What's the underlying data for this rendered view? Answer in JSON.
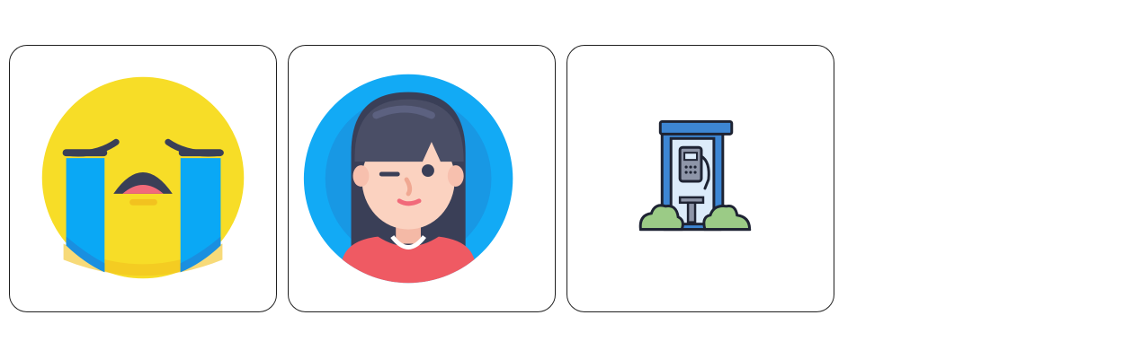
{
  "cards": [
    {
      "icon": "crying-face-icon"
    },
    {
      "icon": "winking-woman-avatar-icon"
    },
    {
      "icon": "phone-booth-icon"
    }
  ],
  "colors": {
    "face_yellow": "#F7DD27",
    "face_shadow": "#F2C21F",
    "tears_blue": "#0AA8F5",
    "tears_dark": "#1A8FE0",
    "features_dark": "#3A3F57",
    "mouth_pink": "#F16A7A",
    "avatar_bg": "#12AAF5",
    "avatar_bg_inner": "#1898E4",
    "hair": "#4A4E66",
    "skin": "#FBD2C0",
    "shirt": "#EF5A63",
    "booth_blue": "#3D86D4",
    "booth_light": "#DCEBFA",
    "bush_green": "#9BCB86",
    "outline": "#1E2333"
  }
}
